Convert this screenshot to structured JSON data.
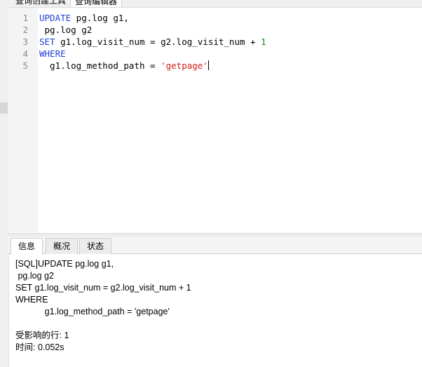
{
  "top_tabs": [
    "查询创建工具",
    "查询编辑器"
  ],
  "editor": {
    "lines": [
      {
        "number": "1",
        "tokens": [
          {
            "t": "UPDATE",
            "k": "kw"
          },
          {
            "t": " pg.log g1,",
            "k": "plain"
          }
        ]
      },
      {
        "number": "2",
        "tokens": [
          {
            "t": " pg.log g2",
            "k": "plain"
          }
        ]
      },
      {
        "number": "3",
        "tokens": [
          {
            "t": "SET",
            "k": "kw"
          },
          {
            "t": " g1.log_visit_num = g2.log_visit_num + ",
            "k": "plain"
          },
          {
            "t": "1",
            "k": "num"
          }
        ]
      },
      {
        "number": "4",
        "tokens": [
          {
            "t": "WHERE",
            "k": "kw"
          }
        ]
      },
      {
        "number": "5",
        "tokens": [
          {
            "t": "  g1.log_method_path = ",
            "k": "plain"
          },
          {
            "t": "'getpage'",
            "k": "str"
          }
        ]
      }
    ]
  },
  "result_tabs": [
    "信息",
    "概况",
    "状态"
  ],
  "result_active_tab": 0,
  "messages": [
    "[SQL]UPDATE pg.log g1,",
    " pg.log g2",
    "SET g1.log_visit_num = g2.log_visit_num + 1",
    "WHERE",
    "            g1.log_method_path = 'getpage'",
    "",
    "受影响的行: 1",
    "时间: 0.052s"
  ],
  "colors": {
    "keyword": "#1f3fd6",
    "number": "#0a8a0a",
    "string": "#d21b1b",
    "line_number": "#8a8a8a"
  }
}
